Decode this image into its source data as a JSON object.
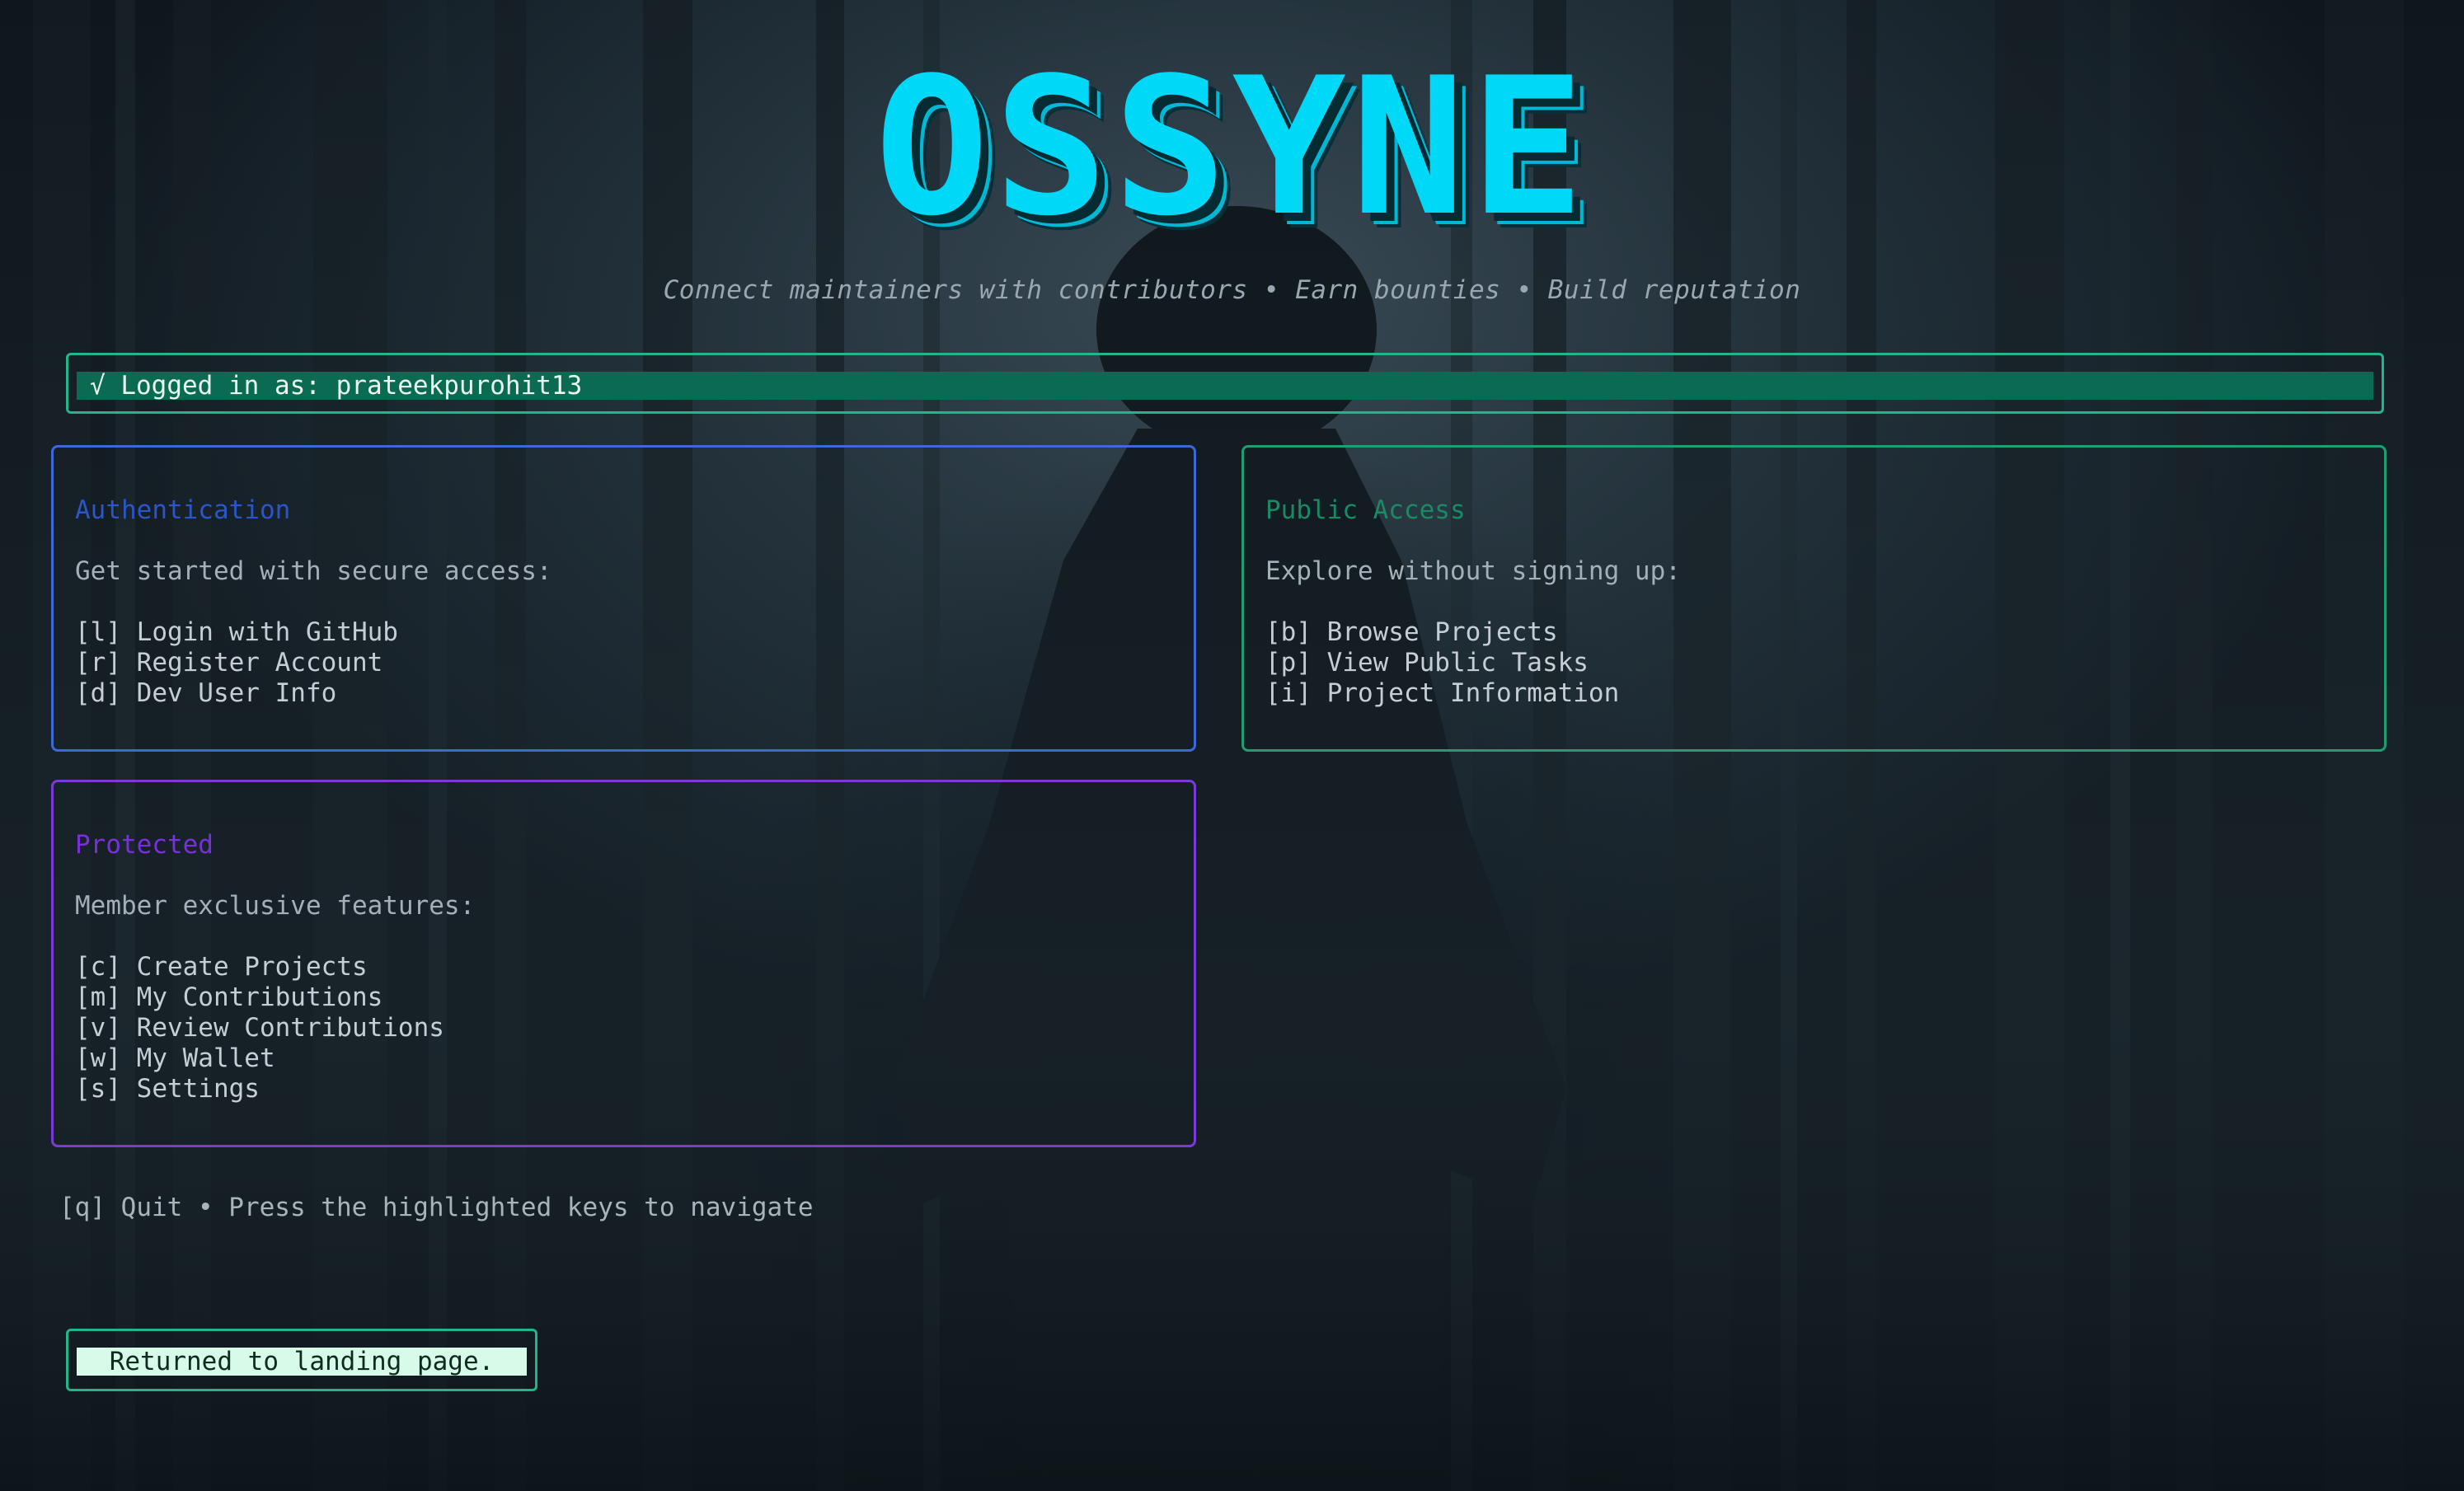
{
  "app": {
    "logo_text": "OSSYNE",
    "tagline": "Connect maintainers with contributors • Earn bounties • Build reputation"
  },
  "status": {
    "icon": "check-icon",
    "text": "√ Logged in as: prateekpurohit13"
  },
  "panels": {
    "authentication": {
      "title": "Authentication",
      "subtitle": "Get started with secure access:",
      "items": [
        {
          "label": "[l] Login with GitHub"
        },
        {
          "label": "[r] Register Account"
        },
        {
          "label": "[d] Dev User Info"
        }
      ]
    },
    "public": {
      "title": "Public Access",
      "subtitle": "Explore without signing up:",
      "items": [
        {
          "label": "[b] Browse Projects"
        },
        {
          "label": "[p] View Public Tasks"
        },
        {
          "label": "[i] Project Information"
        }
      ]
    },
    "protected": {
      "title": "Protected",
      "subtitle": "Member exclusive features:",
      "items": [
        {
          "label": "[c] Create Projects"
        },
        {
          "label": "[m] My Contributions"
        },
        {
          "label": "[v] Review Contributions"
        },
        {
          "label": "[w] My Wallet"
        },
        {
          "label": "[s] Settings"
        }
      ]
    }
  },
  "footer": {
    "hint": "[q] Quit • Press the highlighted keys to navigate"
  },
  "toast": {
    "text": "Returned to landing page."
  },
  "colors": {
    "accent_cyan": "#00d8f8",
    "status_green": "#0b6b52",
    "auth_blue": "#3d68d8",
    "public_green": "#1f9e72",
    "protected_purple": "#7a3ad8"
  }
}
